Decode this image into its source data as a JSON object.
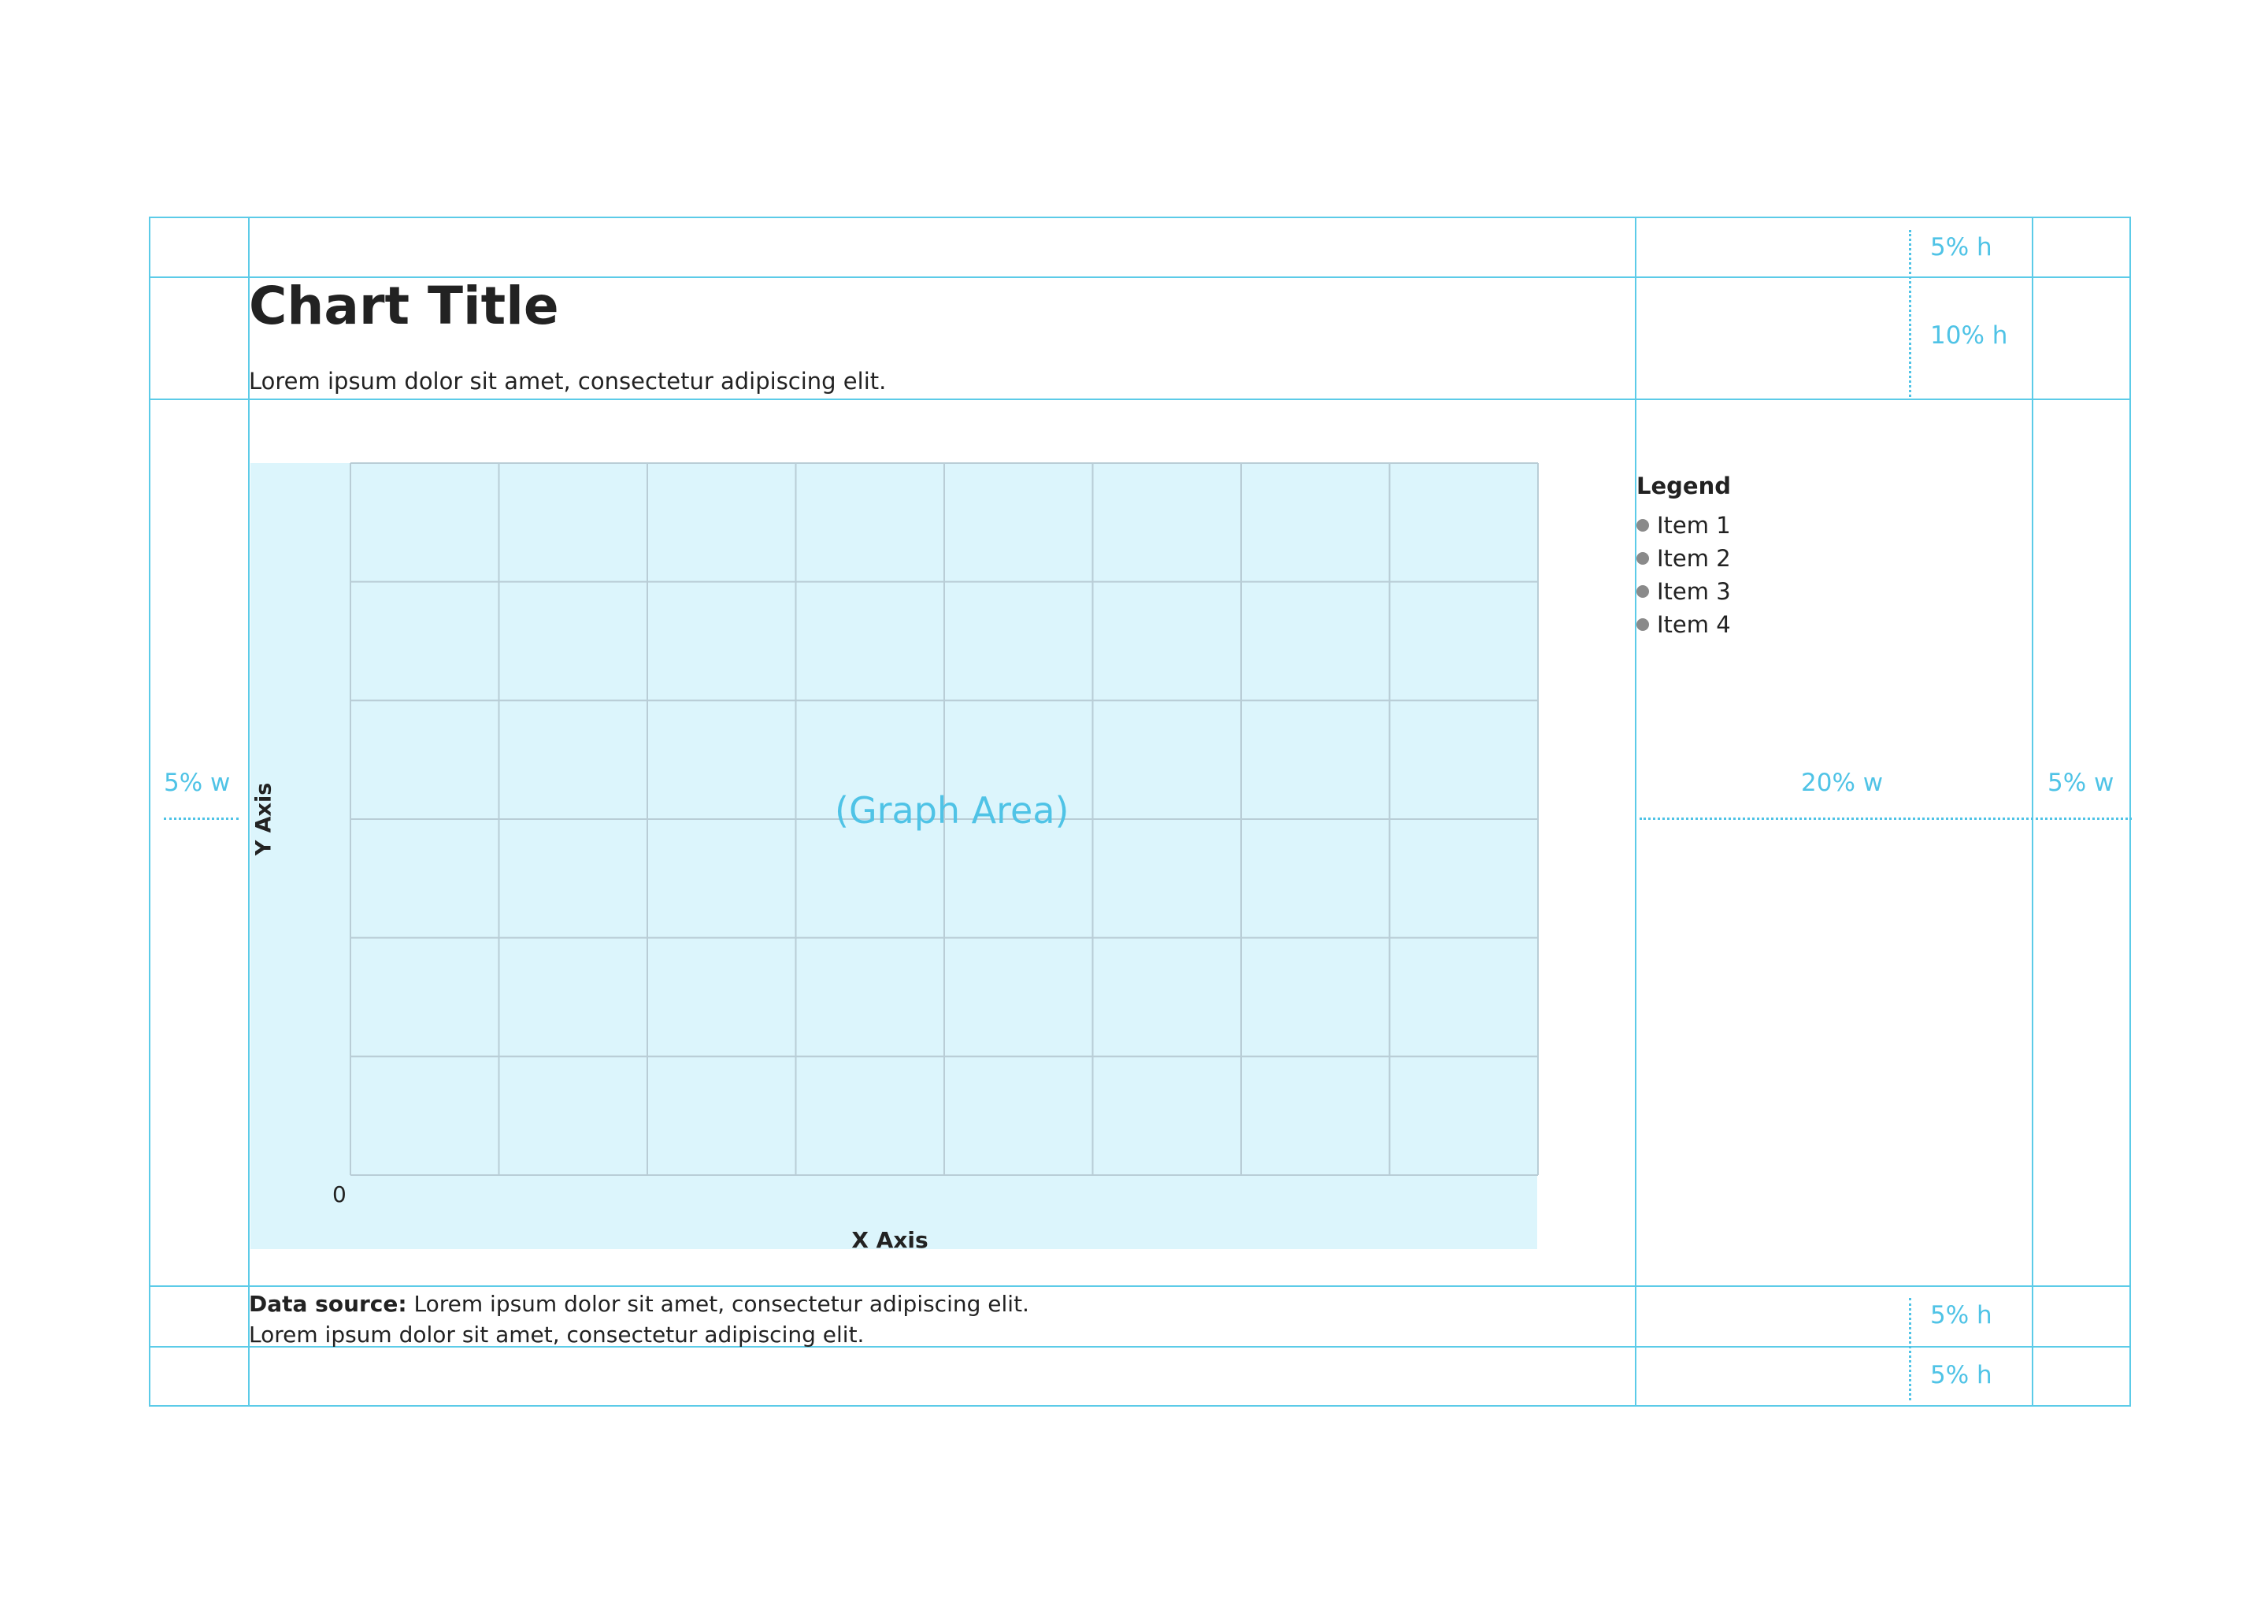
{
  "header": {
    "title": "Chart Title",
    "subtitle": "Lorem ipsum dolor sit amet, consectetur adipiscing elit."
  },
  "graph": {
    "area_label": "(Graph Area)",
    "y_axis_label": "Y Axis",
    "x_axis_label": "X Axis",
    "origin_label": "0",
    "grid_columns": 8,
    "grid_rows": 6
  },
  "legend": {
    "title": "Legend",
    "items": [
      "Item 1",
      "Item 2",
      "Item 3",
      "Item 4"
    ]
  },
  "footer": {
    "source_label": "Data source:",
    "source_text": "Lorem ipsum dolor sit amet, consectetur adipiscing elit.",
    "note": "Lorem ipsum dolor sit amet, consectetur adipiscing elit."
  },
  "measurements": {
    "top_margin": "5% h",
    "header_height": "10% h",
    "left_margin": "5% w",
    "legend_width": "20% w",
    "right_margin": "5% w",
    "footer_height": "5% h",
    "bottom_margin": "5% h"
  },
  "colors": {
    "guide": "#5ccbe8",
    "graph_area": "#dcf5fc",
    "gridline": "#b9cdd6",
    "legend_dot": "#8a8a8a"
  }
}
